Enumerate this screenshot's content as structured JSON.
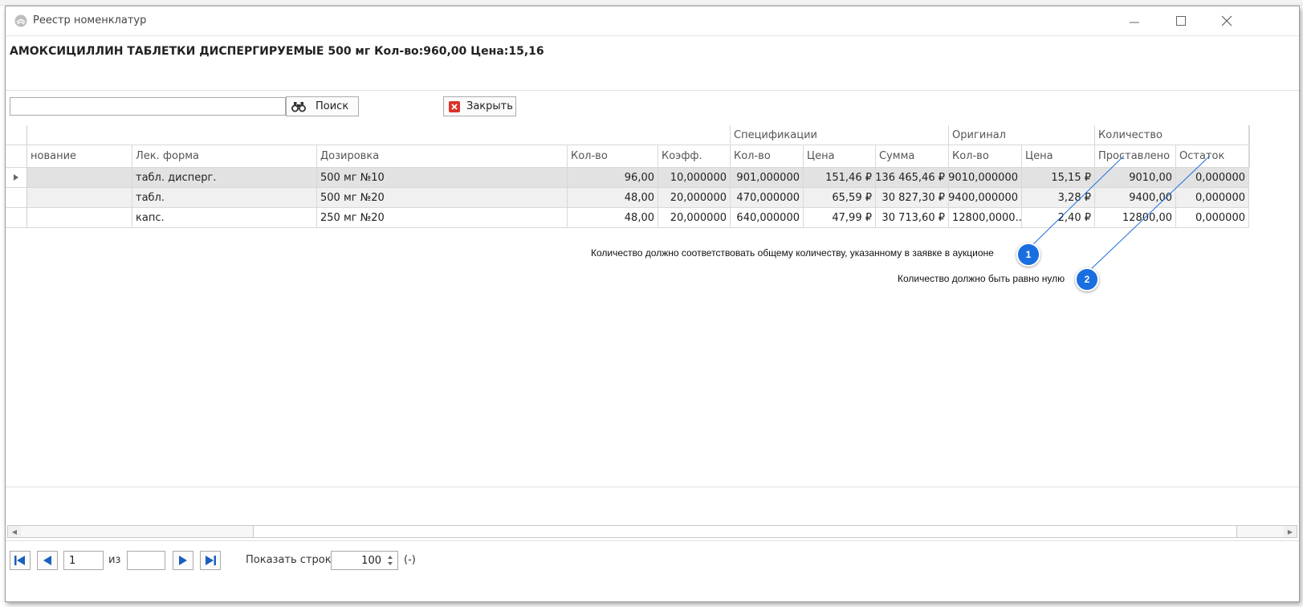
{
  "window": {
    "title": "Реестр номенклатур",
    "minimize_glyph": "—",
    "maximize_glyph": "☐",
    "close_glyph": "✕"
  },
  "header": {
    "title": "АМОКСИЦИЛЛИН ТАБЛЕТКИ ДИСПЕРГИРУЕМЫЕ 500 мг Кол-во:960,00 Цена:15,16"
  },
  "search": {
    "value": "",
    "placeholder": "",
    "search_label": "Поиск",
    "close_label": "Закрыть"
  },
  "grid": {
    "groups": {
      "spec": "Спецификации",
      "orig": "Оригинал",
      "qty": "Количество"
    },
    "columns": [
      "нование",
      "Лек. форма",
      "Дозировка",
      "Кол-во",
      "Коэфф.",
      "Кол-во",
      "Цена",
      "Сумма",
      "Кол-во",
      "Цена",
      "Проставлено",
      "Остаток"
    ],
    "rows": [
      [
        "",
        "табл. дисперг.",
        "500 мг №10",
        "96,00",
        "10,000000",
        "901,000000",
        "151,46 ₽",
        "136 465,46 ₽",
        "9010,000000",
        "15,15 ₽",
        "9010,00",
        "0,000000"
      ],
      [
        "",
        "табл.",
        "500 мг №20",
        "48,00",
        "20,000000",
        "470,000000",
        "65,59 ₽",
        "30 827,30 ₽",
        "9400,000000",
        "3,28 ₽",
        "9400,00",
        "0,000000"
      ],
      [
        "",
        "капс.",
        "250 мг №20",
        "48,00",
        "20,000000",
        "640,000000",
        "47,99 ₽",
        "30 713,60 ₽",
        "12800,0000...",
        "2,40 ₽",
        "12800,00",
        "0,000000"
      ]
    ]
  },
  "callouts": [
    {
      "number": "1",
      "text": "Количество должно соответствовать общему количеству, указанному в заявке в аукционе"
    },
    {
      "number": "2",
      "text": "Количество должно быть равно нулю"
    }
  ],
  "pager": {
    "current_page": "1",
    "of_label": "из",
    "total_pages": "",
    "rows_label": "Показать строк",
    "rows_value": "100",
    "rows_suffix": "(-)"
  },
  "colors": {
    "badge": "#1a6fe0",
    "nav_blue": "#1a5fbf",
    "close_red": "#d9342b"
  }
}
